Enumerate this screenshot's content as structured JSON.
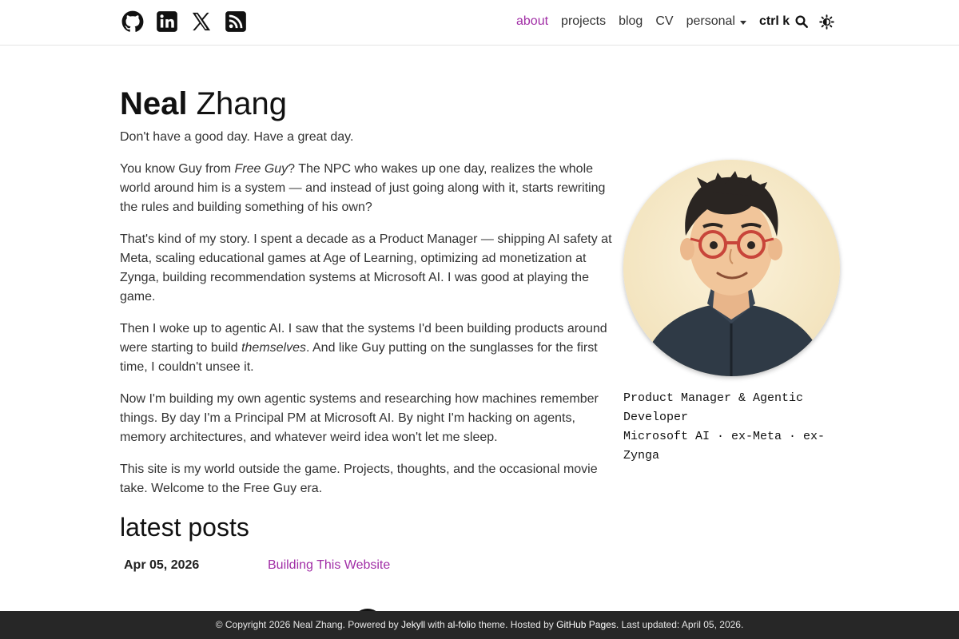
{
  "social": [
    {
      "icon": "github-icon"
    },
    {
      "icon": "linkedin-icon"
    },
    {
      "icon": "x-icon"
    },
    {
      "icon": "rss-icon"
    }
  ],
  "nav": {
    "about": "about",
    "projects": "projects",
    "blog": "blog",
    "cv": "CV",
    "personal": "personal",
    "ctrlk": "ctrl k",
    "active_color": "#a12ea6"
  },
  "title": {
    "first": "Neal",
    "last": "Zhang"
  },
  "intro": {
    "p0": "Don't have a good day. Have a great day.",
    "p1a": "You know Guy from ",
    "p1em": "Free Guy",
    "p1b": "? The NPC who wakes up one day, realizes the whole world around him is a system — and instead of just going along with it, starts rewriting the rules and building something of his own?",
    "p2": "That's kind of my story. I spent a decade as a Product Manager — shipping AI safety at Meta, scaling educational games at Age of Learning, optimizing ad monetization at Zynga, building recommendation systems at Microsoft AI. I was good at playing the game.",
    "p3a": "Then I woke up to agentic AI. I saw that the systems I'd been building products around were starting to build ",
    "p3em": "themselves",
    "p3b": ". And like Guy putting on the sunglasses for the first time, I couldn't unsee it.",
    "p4": "Now I'm building my own agentic systems and researching how machines remember things. By day I'm a Principal PM at Microsoft AI. By night I'm hacking on agents, memory architectures, and whatever weird idea won't let me sleep.",
    "p5": "This site is my world outside the game. Projects, thoughts, and the occasional movie take. Welcome to the Free Guy era."
  },
  "profile": {
    "caption_line1": "Product Manager & Agentic Developer",
    "caption_line2": "Microsoft AI · ex-Meta · ex-Zynga"
  },
  "latest_posts": {
    "heading": "latest posts",
    "items": [
      {
        "date": "Apr 05, 2026",
        "title": "Building This Website"
      }
    ]
  },
  "footer": {
    "pre": "© Copyright 2026 Neal Zhang. Powered by ",
    "jekyll": "Jekyll",
    "mid1": " with ",
    "alfolio": "al-folio",
    "mid2": " theme. Hosted by ",
    "ghpages": "GitHub Pages",
    "post": ". Last updated: April 05, 2026."
  }
}
